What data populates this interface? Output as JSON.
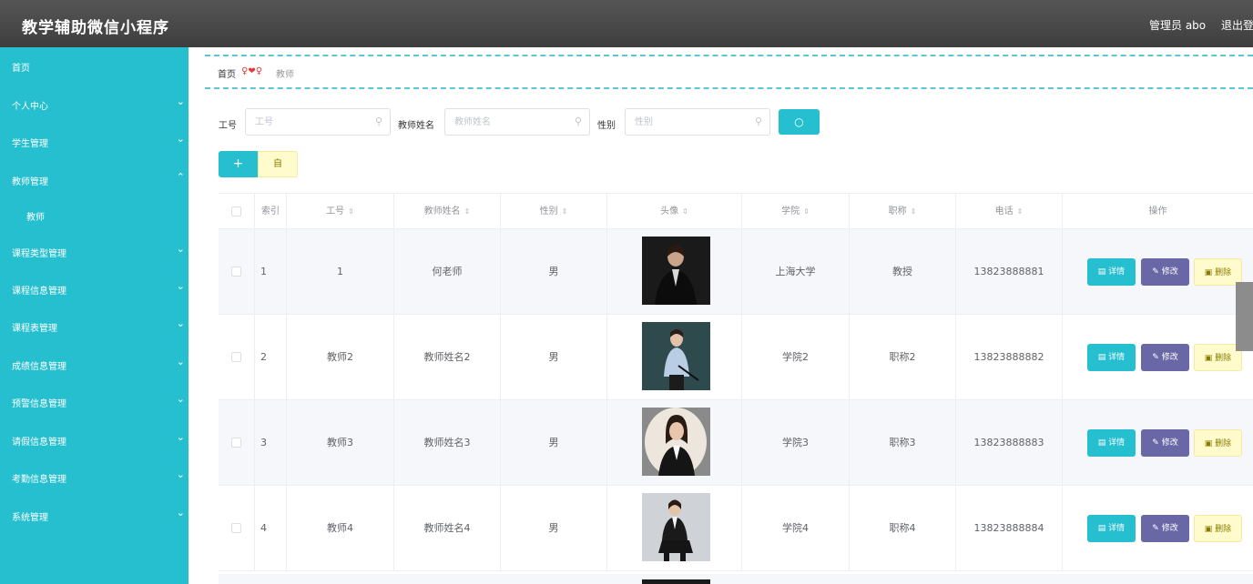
{
  "header": {
    "app_title": "教学辅助微信小程序",
    "admin_label": "管理员 abo",
    "logout_label": "退出登"
  },
  "sidebar": {
    "items": [
      {
        "label": "首页",
        "has_chevron": false
      },
      {
        "label": "个人中心",
        "has_chevron": true
      },
      {
        "label": "学生管理",
        "has_chevron": true
      },
      {
        "label": "教师管理",
        "has_chevron": true,
        "expanded": true
      },
      {
        "label": "教师",
        "sub": true
      },
      {
        "label": "课程类型管理",
        "has_chevron": true
      },
      {
        "label": "课程信息管理",
        "has_chevron": true
      },
      {
        "label": "课程表管理",
        "has_chevron": true
      },
      {
        "label": "成绩信息管理",
        "has_chevron": true
      },
      {
        "label": "预警信息管理",
        "has_chevron": true
      },
      {
        "label": "请假信息管理",
        "has_chevron": true
      },
      {
        "label": "考勤信息管理",
        "has_chevron": true
      },
      {
        "label": "系统管理",
        "has_chevron": true
      }
    ]
  },
  "breadcrumb": {
    "home": "首页",
    "separator": "♀❤♀",
    "current": "教师"
  },
  "filters": {
    "gonghao_label": "工号",
    "gonghao_placeholder": "工号",
    "name_label": "教师姓名",
    "name_placeholder": "教师姓名",
    "gender_label": "性别",
    "gender_placeholder": "性别",
    "search_icon": "search-icon"
  },
  "actions": {
    "add_label": "+",
    "delete_label": "自"
  },
  "table": {
    "columns": [
      "索引",
      "工号",
      "教师姓名",
      "性别",
      "头像",
      "学院",
      "职称",
      "电话",
      "操作"
    ],
    "rows": [
      {
        "index": "1",
        "gonghao": "1",
        "name": "何老师",
        "gender": "男",
        "college": "上海大学",
        "title": "教授",
        "phone": "13823888881"
      },
      {
        "index": "2",
        "gonghao": "教师2",
        "name": "教师姓名2",
        "gender": "男",
        "college": "学院2",
        "title": "职称2",
        "phone": "13823888882"
      },
      {
        "index": "3",
        "gonghao": "教师3",
        "name": "教师姓名3",
        "gender": "男",
        "college": "学院3",
        "title": "职称3",
        "phone": "13823888883"
      },
      {
        "index": "4",
        "gonghao": "教师4",
        "name": "教师姓名4",
        "gender": "男",
        "college": "学院4",
        "title": "职称4",
        "phone": "13823888884"
      }
    ],
    "op_labels": {
      "detail": "详情",
      "edit": "修改",
      "delete": "删除"
    }
  },
  "colors": {
    "accent": "#26bfcf",
    "edit_button": "#6a67a6",
    "delete_button": "#fffbcc",
    "header_bg": "#474747"
  }
}
